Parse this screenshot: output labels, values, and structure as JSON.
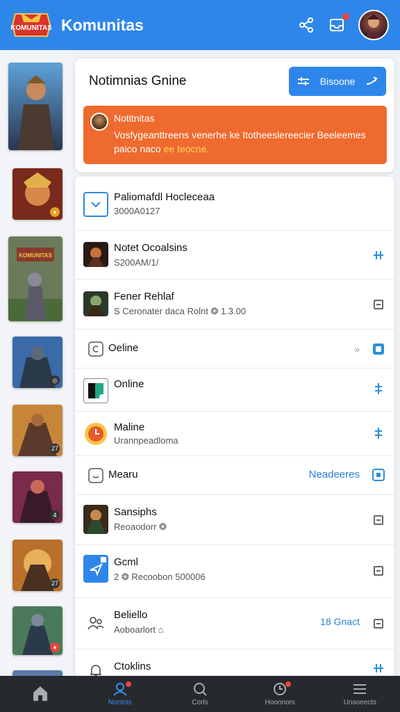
{
  "header": {
    "app_title": "Komunitas",
    "logo_text": "KOMUNITAS",
    "icons": [
      "share-icon",
      "inbox-icon"
    ],
    "accent_color": "#2f86ea"
  },
  "card": {
    "title": "Notimnias Gnine",
    "primary_button_label": "Bisoone",
    "alert": {
      "title": "Notitnitas",
      "body_line1": "Vosfygeanttreens venerhe ke Itotheeslereecier Beeleemes",
      "body_pre": "paico naco ",
      "body_highlight": "ee teocne.",
      "color": "#ef6a2e"
    }
  },
  "list": {
    "rows": [
      {
        "title": "Paliomafdl Hocleceaa",
        "subtitle": "3000A0127",
        "link": "",
        "icon": "check-icon"
      },
      {
        "title": "Notet Ocoalsins",
        "subtitle": "S200AM/1/",
        "link": "",
        "icon": "game-thumbnail-icon"
      },
      {
        "title": "Fener Rehlaf",
        "subtitle": "S Ceronater daca Rolnt ❂ 1.3.00",
        "link": "",
        "icon": "game-thumbnail-icon"
      },
      {
        "title": "Oeline",
        "subtitle": "",
        "link": "»",
        "icon": "status-icon"
      },
      {
        "title": "Online",
        "subtitle": "",
        "link": "",
        "icon": "app-icon"
      },
      {
        "title": "Maline",
        "subtitle": "Urannpeadloma",
        "link": "",
        "icon": "clock-icon"
      },
      {
        "title": "Mearu",
        "subtitle": "",
        "link": "Neadeeres",
        "icon": "smile-icon"
      },
      {
        "title": "Sansiphs",
        "subtitle": "Reoaodorr ❂",
        "link": "",
        "icon": "game-thumbnail-icon"
      },
      {
        "title": "Gcml",
        "subtitle": "2 ❂ Recoobon 500006",
        "link": "",
        "icon": "send-icon"
      },
      {
        "title": "Beliello",
        "subtitle": "Aoboarlort ⌂",
        "link": "18 Gnact",
        "icon": "group-icon"
      },
      {
        "title": "Ctoklins",
        "subtitle": "",
        "link": "",
        "icon": "bell-icon"
      }
    ]
  },
  "rail": {
    "thumbnails": [
      {
        "badge": ""
      },
      {
        "badge": "♦"
      },
      {
        "badge": "",
        "caption": "KOMUNITAS"
      },
      {
        "badge": "◎"
      },
      {
        "badge": "27"
      },
      {
        "badge": "4"
      },
      {
        "badge": "27"
      },
      {
        "badge": "♦"
      }
    ]
  },
  "bottom_nav": {
    "items": [
      {
        "label": "",
        "icon": "home-icon"
      },
      {
        "label": "Nontnis",
        "icon": "community-icon"
      },
      {
        "label": "Corls",
        "icon": "search-icon"
      },
      {
        "label": "Hoonnors",
        "icon": "notification-icon"
      },
      {
        "label": "Unsoeects",
        "icon": "menu-icon"
      }
    ]
  }
}
